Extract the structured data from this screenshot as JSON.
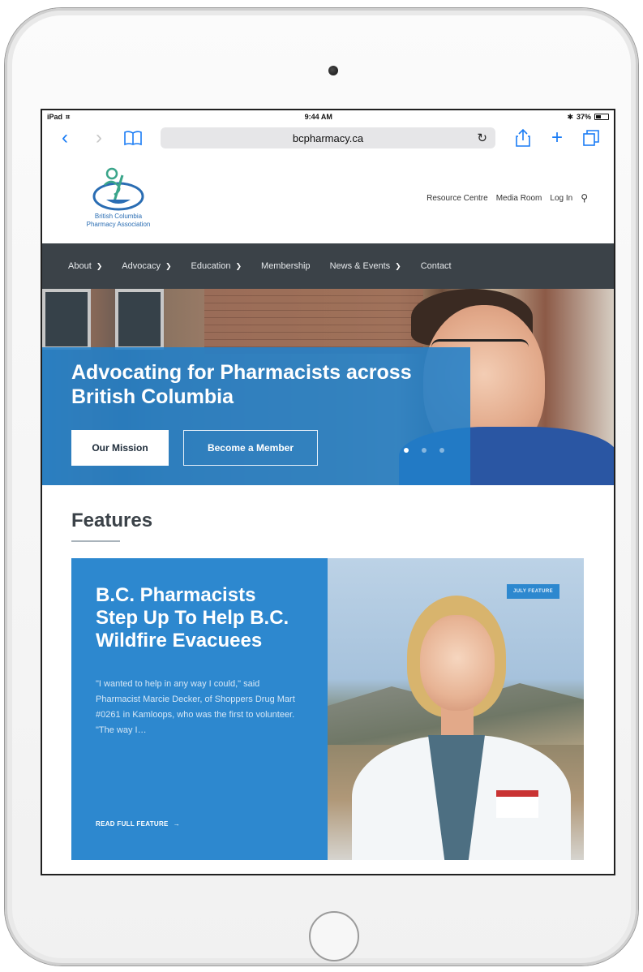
{
  "status_bar": {
    "device": "iPad",
    "time": "9:44 AM",
    "battery": "37%"
  },
  "browser": {
    "url": "bcpharmacy.ca",
    "accent": "#1a7cf5"
  },
  "site": {
    "logo_line1": "British Columbia",
    "logo_line2": "Pharmacy Association",
    "utility_nav": [
      "Resource Centre",
      "Media Room",
      "Log In"
    ],
    "main_nav": [
      {
        "label": "About",
        "has_dropdown": true
      },
      {
        "label": "Advocacy",
        "has_dropdown": true
      },
      {
        "label": "Education",
        "has_dropdown": true
      },
      {
        "label": "Membership",
        "has_dropdown": false
      },
      {
        "label": "News & Events",
        "has_dropdown": true
      },
      {
        "label": "Contact",
        "has_dropdown": false
      }
    ],
    "nav_color": "#3b4248"
  },
  "hero": {
    "title": "Advocating for Pharmacists across British Columbia",
    "primary_button": "Our Mission",
    "secondary_button": "Become a Member",
    "slides": 3,
    "active_slide": 1,
    "overlay_color": "#2180c9"
  },
  "features": {
    "title": "Features",
    "card": {
      "heading": "B.C. Pharmacists Step Up To Help B.C. Wildfire Evacuees",
      "quote": "\"I wanted to help in any way I could,\" said Pharmacist Marcie Decker, of Shoppers Drug Mart #0261 in Kamloops, who was the first to volunteer. \"The way I…",
      "link": "READ FULL FEATURE",
      "tag": "JULY FEATURE",
      "color": "#2d88cf"
    }
  }
}
